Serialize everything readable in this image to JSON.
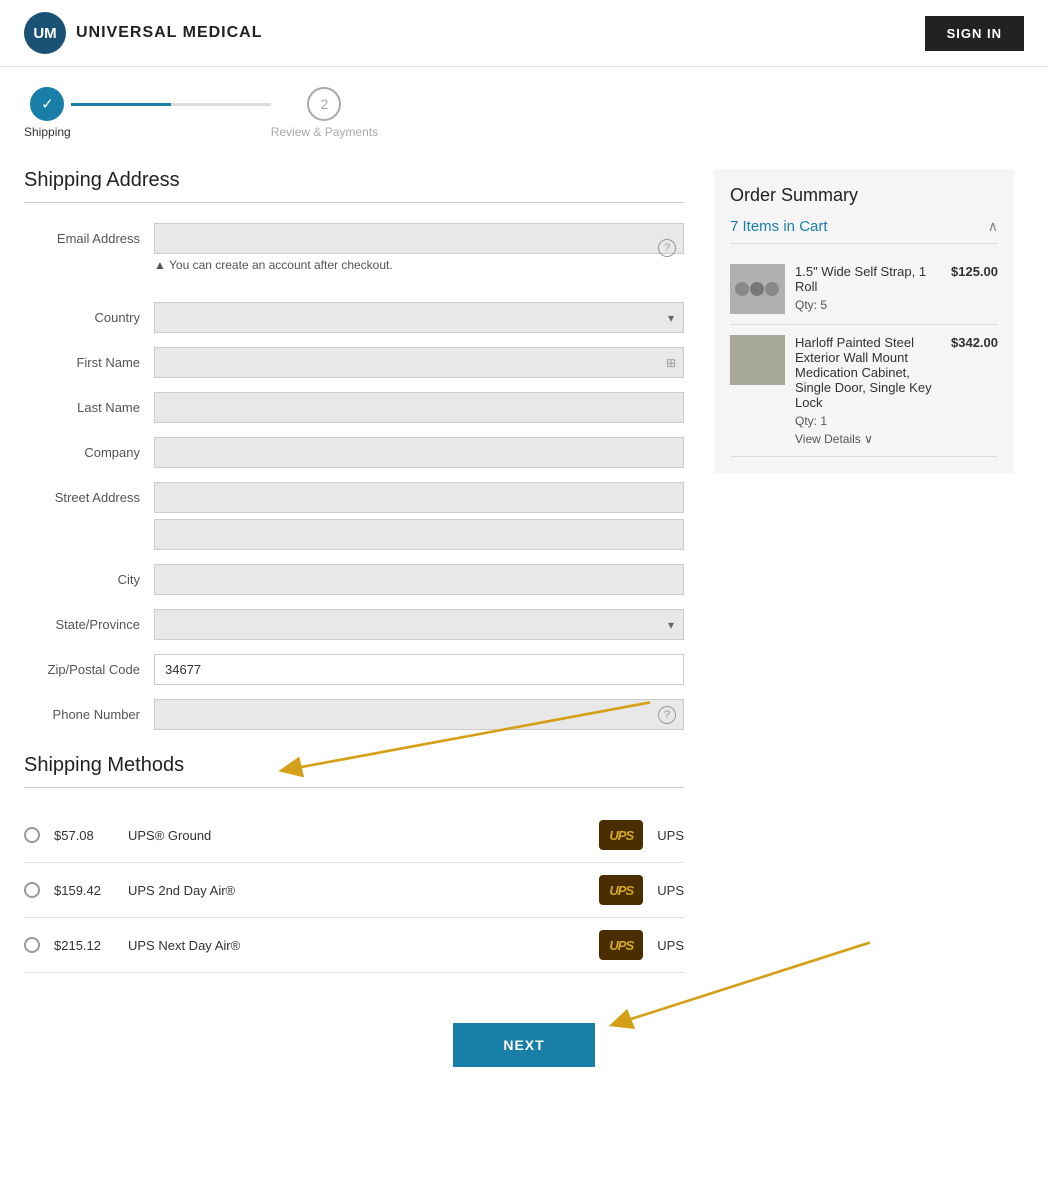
{
  "header": {
    "logo_initials": "UM",
    "logo_name": "UNIVERSAL MEDICAL",
    "sign_in_label": "SIGN IN"
  },
  "progress": {
    "step1_label": "Shipping",
    "step2_label": "Review & Payments",
    "step2_number": "2"
  },
  "form": {
    "section_title": "Shipping Address",
    "email_label": "Email Address",
    "email_placeholder": "",
    "email_hint": "▲ You can create an account after checkout.",
    "country_label": "Country",
    "firstname_label": "First Name",
    "lastname_label": "Last Name",
    "company_label": "Company",
    "street_label": "Street Address",
    "city_label": "City",
    "state_label": "State/Province",
    "zip_label": "Zip/Postal Code",
    "zip_value": "34677",
    "phone_label": "Phone Number",
    "phone_placeholder": ""
  },
  "order_summary": {
    "title": "Order Summary",
    "items_in_cart_label": "7 Items in Cart",
    "items": [
      {
        "name": "1.5\" Wide Self Strap, 1 Roll",
        "price": "$125.00",
        "qty": "Qty: 5"
      },
      {
        "name": "Harloff Painted Steel Exterior Wall Mount Medication Cabinet, Single Door, Single Key Lock",
        "price": "$342.00",
        "qty": "Qty: 1",
        "view_details": "View Details"
      }
    ]
  },
  "shipping_methods": {
    "title": "Shipping Methods",
    "methods": [
      {
        "price": "$57.08",
        "name": "UPS® Ground",
        "carrier": "UPS"
      },
      {
        "price": "$159.42",
        "name": "UPS 2nd Day Air®",
        "carrier": "UPS"
      },
      {
        "price": "$215.12",
        "name": "UPS Next Day Air®",
        "carrier": "UPS"
      }
    ]
  },
  "next_button_label": "NEXT"
}
